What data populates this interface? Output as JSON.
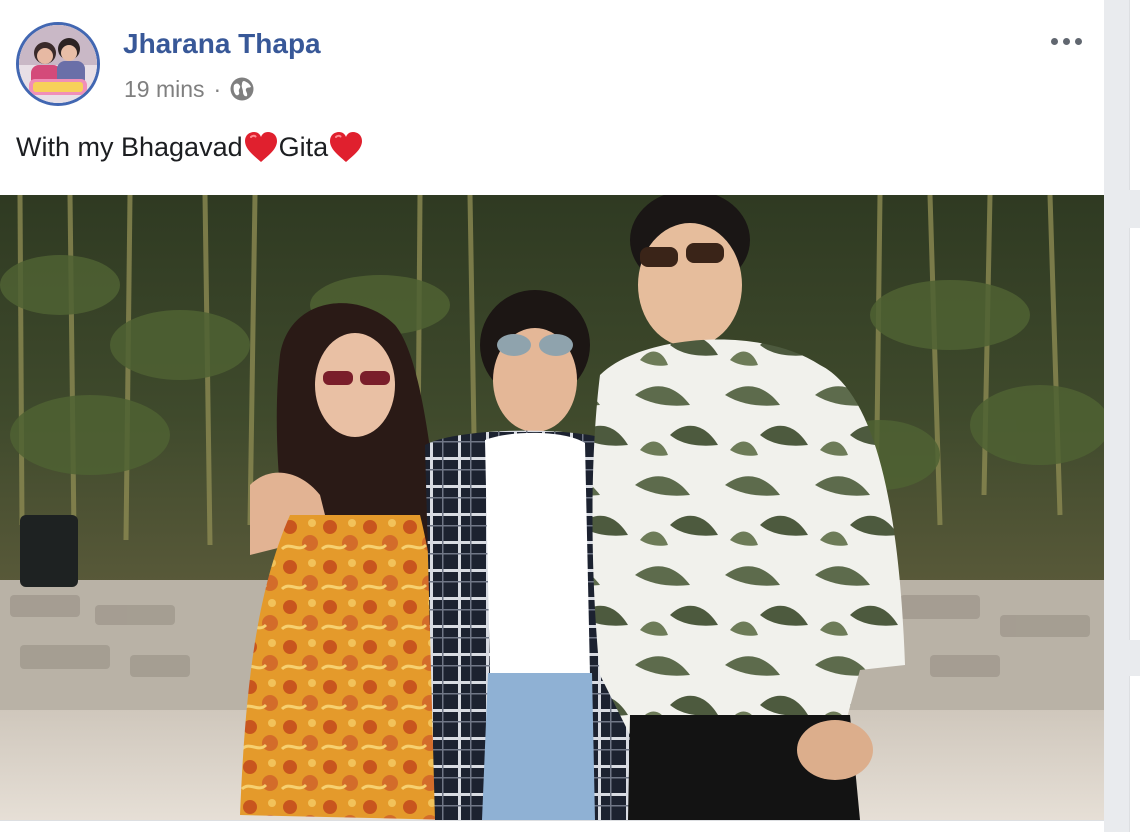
{
  "post": {
    "author": "Jharana Thapa",
    "timestamp": "19 mins",
    "separator": "·",
    "privacy_icon": "globe-icon",
    "more_icon": "more-options-icon",
    "caption_parts": [
      "With my Bhagavad",
      "Gita"
    ],
    "caption_emoji": "red-heart",
    "photo_icon": "post-photo"
  },
  "colors": {
    "author_link": "#385898",
    "avatar_ring": "#4267b2",
    "meta_text": "#7f7f7f",
    "heart": "#e0202e"
  }
}
